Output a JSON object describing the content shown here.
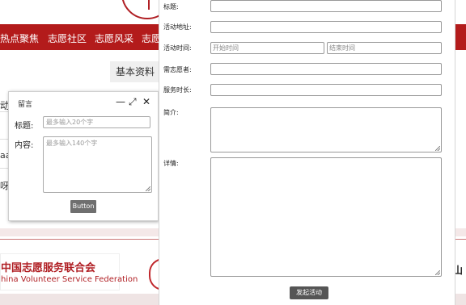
{
  "nav": {
    "items": [
      "热点聚焦",
      "志愿社区",
      "志愿风采",
      "志愿"
    ]
  },
  "profile_tab": "基本资料",
  "partial_texts": [
    "动",
    "aa",
    "呀"
  ],
  "footer": {
    "cvsf_cn": "中国志愿服务联合会",
    "cvsf_en": "hina Volunteer Service Federation",
    "right_fragment": "山"
  },
  "message_dialog": {
    "title": "留言",
    "controls": {
      "minimize": "—",
      "maximize": "⤢",
      "close": "✕"
    },
    "title_label": "标题:",
    "title_placeholder": "最多输入20个字",
    "content_label": "内容:",
    "content_placeholder": "最多输入140个字",
    "button_label": "Button"
  },
  "activity_form": {
    "fields": {
      "title_label": "标题:",
      "address_label": "活动地址:",
      "time_label": "活动时间:",
      "start_placeholder": "开始时间",
      "end_placeholder": "结束时间",
      "volunteers_label": "需志愿者:",
      "duration_label": "服务时长:",
      "intro_label": "简介:",
      "details_label": "详情:"
    },
    "submit_label": "发起活动"
  }
}
